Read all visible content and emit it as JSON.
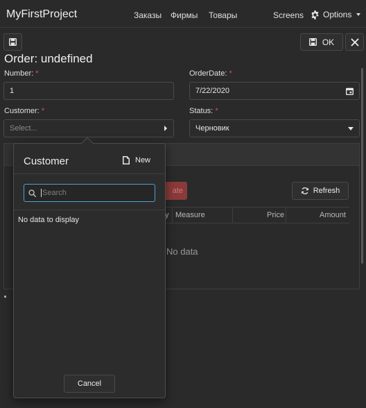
{
  "app": {
    "title": "MyFirstProject"
  },
  "nav": {
    "items": [
      "Заказы",
      "Фирмы",
      "Товары"
    ],
    "screens": "Screens",
    "options": "Options"
  },
  "toolbar": {
    "ok_label": "OK"
  },
  "form": {
    "title": "Order: undefined",
    "number_label": "Number:",
    "number_value": "1",
    "orderdate_label": "OrderDate:",
    "orderdate_value": "7/22/2020",
    "customer_label": "Customer:",
    "customer_placeholder": "Select...",
    "status_label": "Status:",
    "status_value": "Черновик",
    "required_mark": "*"
  },
  "lines": {
    "create_label": "ate",
    "refresh_label": "Refresh",
    "columns": [
      "y",
      "Measure",
      "Price",
      "Amount"
    ],
    "empty_text": "No data"
  },
  "popup": {
    "title": "Customer",
    "new_label": "New",
    "search_placeholder": "Search",
    "empty_text": "No data to display",
    "cancel_label": "Cancel"
  },
  "colors": {
    "background": "#2a2a2a",
    "required": "#e05050",
    "focus": "#4aa3d6",
    "create_button": "#8a3a3a"
  },
  "icons": [
    "save-icon",
    "close-icon",
    "gear-icon",
    "calendar-icon",
    "chevron-right-icon",
    "chevron-down-icon",
    "file-icon",
    "search-icon",
    "refresh-icon"
  ]
}
